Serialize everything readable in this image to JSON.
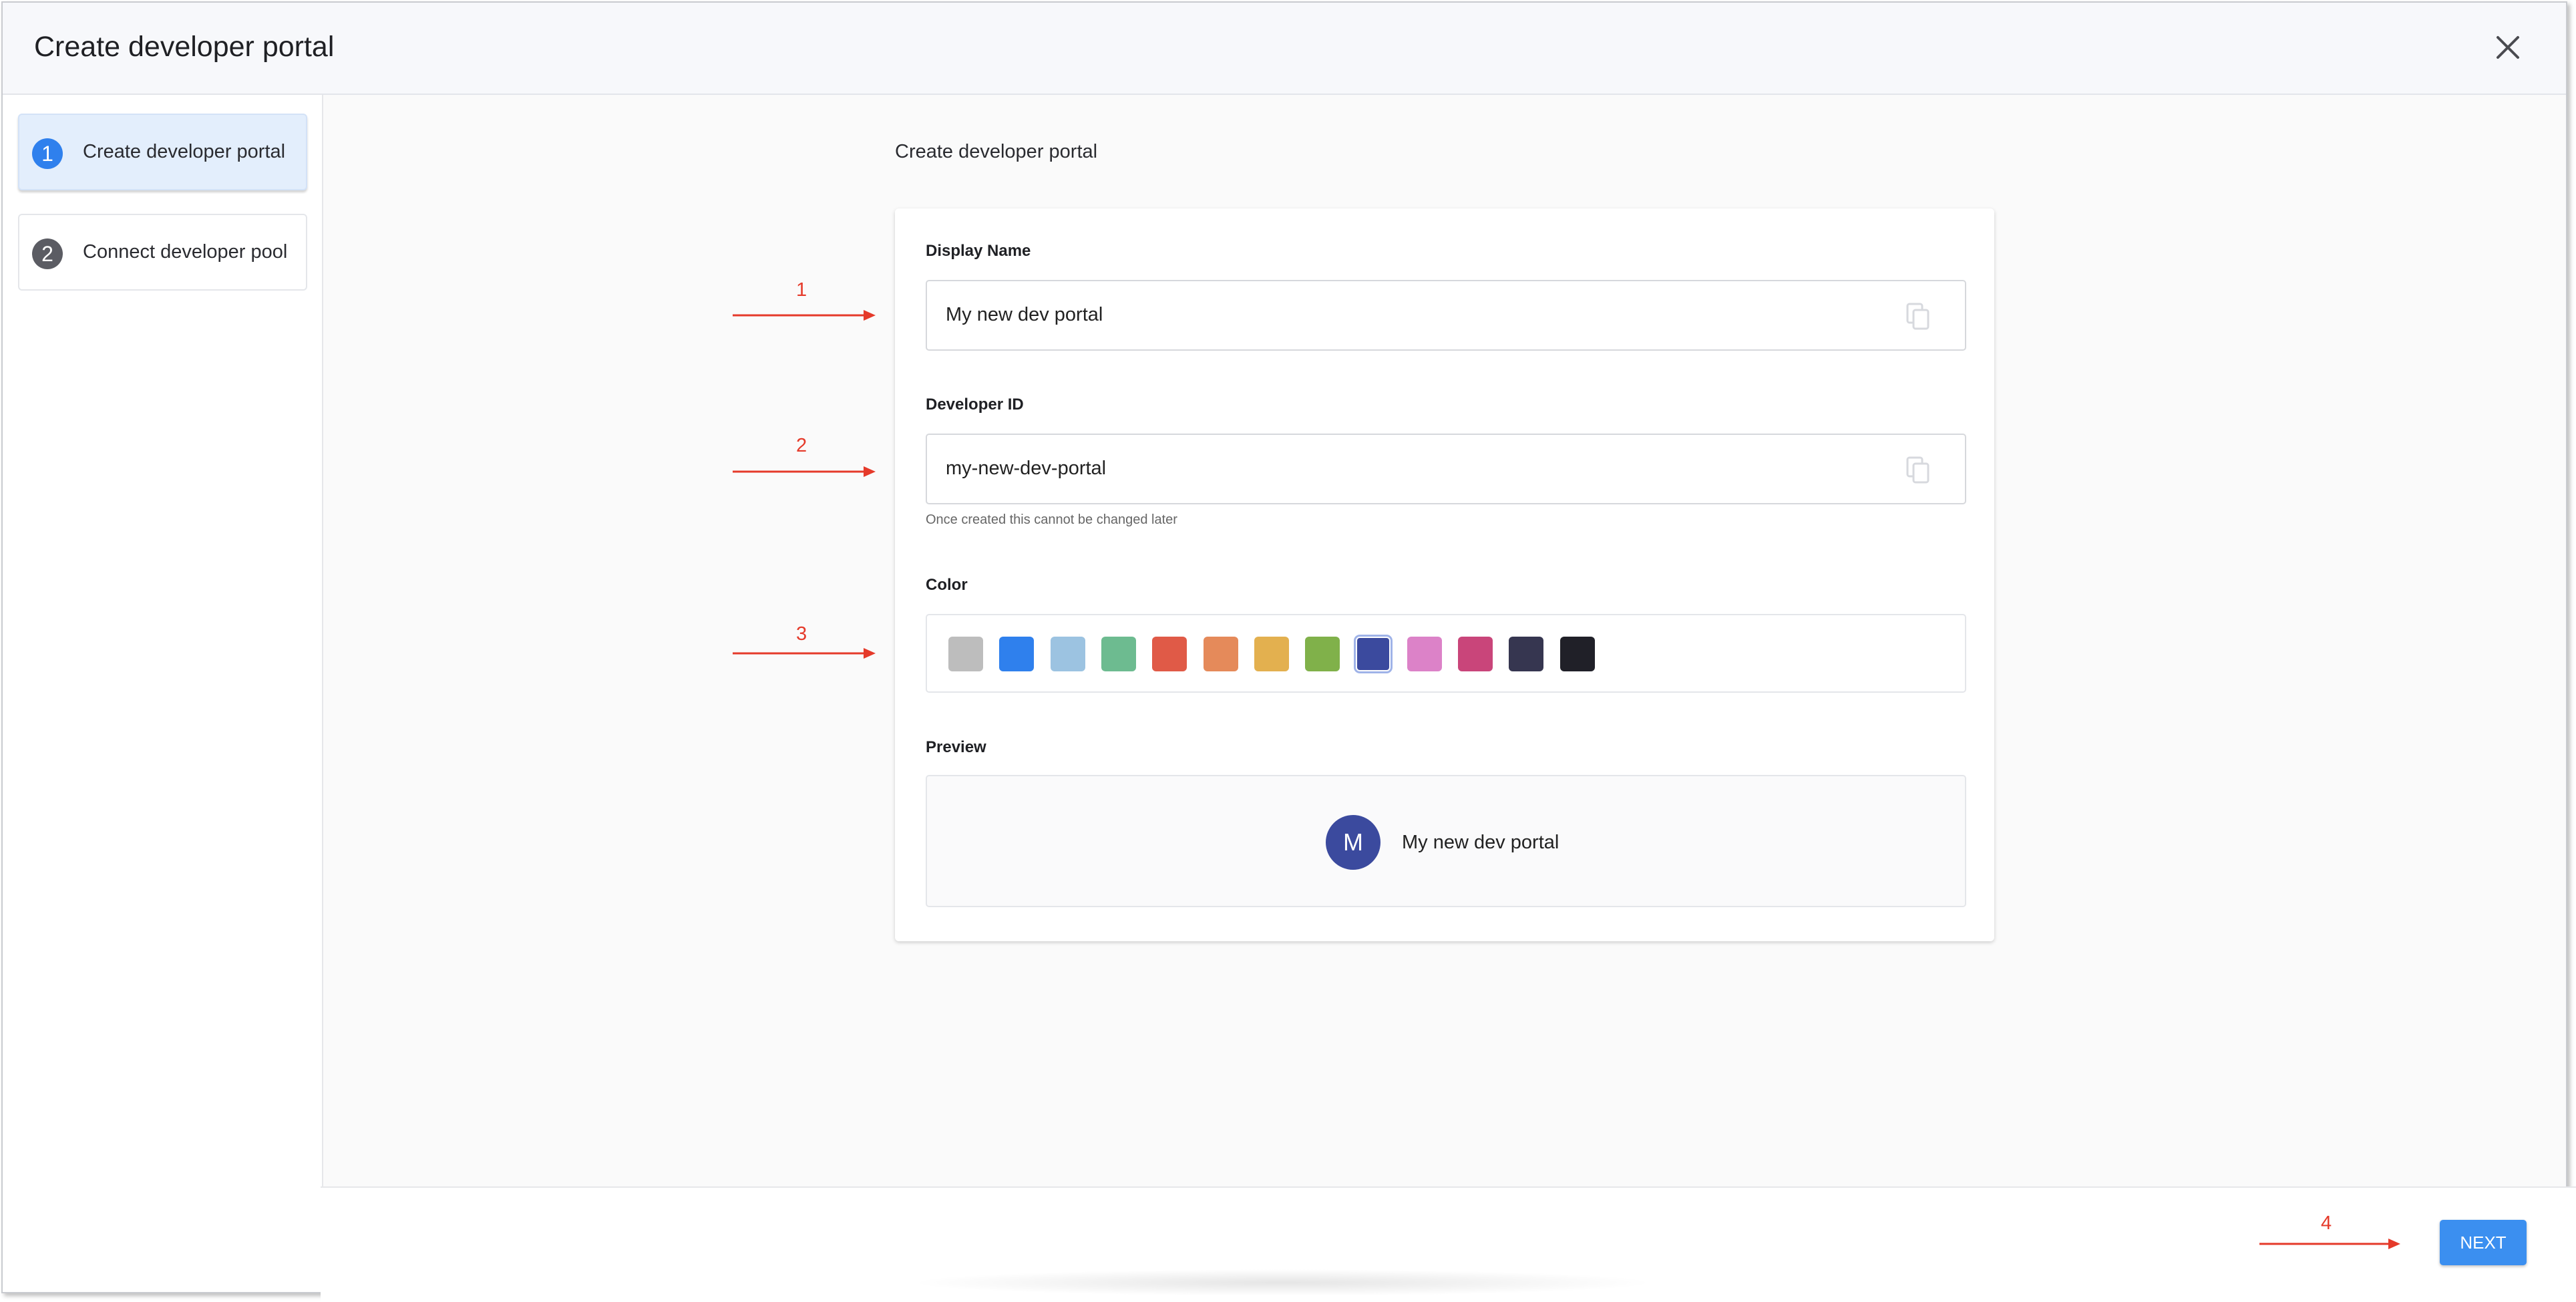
{
  "dialog": {
    "title": "Create developer portal"
  },
  "sidebar": {
    "steps": [
      {
        "number": "1",
        "label": "Create developer portal",
        "active": true
      },
      {
        "number": "2",
        "label": "Connect developer pool",
        "active": false
      }
    ]
  },
  "main": {
    "title": "Create developer portal",
    "display_name": {
      "label": "Display Name",
      "value": "My new dev portal"
    },
    "developer_id": {
      "label": "Developer ID",
      "value": "my-new-dev-portal",
      "helper": "Once created this cannot be changed later"
    },
    "color": {
      "label": "Color",
      "swatches": [
        "#bdbdbd",
        "#2f80ed",
        "#9cc3e1",
        "#6dbb90",
        "#e05a47",
        "#e58a5a",
        "#e3b04f",
        "#80b14a",
        "#3b4a9e",
        "#dc82c8",
        "#c9457a",
        "#363650",
        "#202028"
      ],
      "selected_index": 8
    },
    "preview": {
      "label": "Preview",
      "avatar_letter": "M",
      "name": "My new dev portal",
      "avatar_color": "#3b4a9e"
    }
  },
  "footer": {
    "next_label": "NEXT",
    "next_color": "#3b8ff0"
  },
  "annotations": [
    "1",
    "2",
    "3",
    "4"
  ],
  "colors": {
    "accent": "#2f80ed",
    "annotation": "#e53a2a"
  }
}
